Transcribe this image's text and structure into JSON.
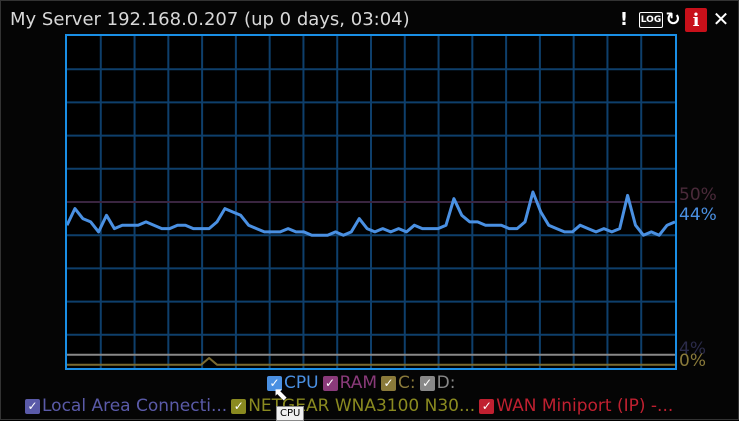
{
  "window": {
    "title": "My Server 192.168.0.207 (up 0 days, 03:04)"
  },
  "title_buttons": {
    "alert": "!",
    "log": "LOG",
    "refresh": "↻",
    "info": "i",
    "close": "✕"
  },
  "colors": {
    "grid": "#0e3f6b",
    "cpu": "#4a90e2",
    "ram": "#3a2540",
    "disk_c": "#7a6a30",
    "disk_d": "#888888",
    "frame": "#1a8fe6"
  },
  "readouts": {
    "ram": "50%",
    "cpu": "44%",
    "low_a": "4%",
    "low_b": "0%"
  },
  "legend": {
    "row1": [
      {
        "label": "CPU",
        "color": "#4a90e2"
      },
      {
        "label": "RAM",
        "color": "#8a3a7a"
      },
      {
        "label": "C:",
        "color": "#8a7a3a"
      },
      {
        "label": "D:",
        "color": "#888888"
      }
    ],
    "row2": [
      {
        "label": "Local Area Connecti...",
        "color": "#5a5aa8"
      },
      {
        "label": "NETGEAR WNA3100 N30...",
        "color": "#8a8a20"
      },
      {
        "label": "WAN Miniport (IP) -...",
        "color": "#c02030"
      }
    ]
  },
  "tooltip": "CPU",
  "chart_data": {
    "type": "line",
    "ylim": [
      0,
      100
    ],
    "grid": true,
    "series": [
      {
        "name": "CPU",
        "values": [
          43,
          48,
          45,
          44,
          41,
          46,
          42,
          43,
          43,
          43,
          44,
          43,
          42,
          42,
          43,
          43,
          42,
          42,
          42,
          44,
          48,
          47,
          46,
          43,
          42,
          41,
          41,
          41,
          42,
          41,
          41,
          40,
          40,
          40,
          41,
          40,
          41,
          45,
          42,
          41,
          42,
          41,
          42,
          41,
          43,
          42,
          42,
          42,
          43,
          51,
          46,
          44,
          44,
          43,
          43,
          43,
          42,
          42,
          44,
          53,
          47,
          43,
          42,
          41,
          41,
          43,
          42,
          41,
          42,
          41,
          42,
          52,
          43,
          40,
          41,
          40,
          43,
          44
        ]
      },
      {
        "name": "RAM",
        "values": [
          50,
          50,
          50,
          50,
          50,
          50,
          50,
          50,
          50,
          50,
          50,
          50,
          50,
          50,
          50,
          50,
          50,
          50,
          50,
          50,
          50,
          50,
          50,
          50,
          50,
          50,
          50,
          50,
          50,
          50,
          50,
          50,
          50,
          50,
          50,
          50,
          50,
          50,
          50,
          50,
          50,
          50,
          50,
          50,
          50,
          50,
          50,
          50,
          50,
          50,
          50,
          50,
          50,
          50,
          50,
          50,
          50,
          50,
          50,
          50,
          50,
          50,
          50,
          50,
          50,
          50,
          50,
          50,
          50,
          50,
          50,
          50,
          50,
          50,
          50,
          50,
          50,
          50
        ]
      },
      {
        "name": "C:",
        "values": [
          1,
          1,
          1,
          1,
          1,
          1,
          1,
          1,
          1,
          1,
          1,
          1,
          1,
          1,
          1,
          1,
          1,
          1,
          3,
          1,
          1,
          1,
          1,
          1,
          1,
          1,
          1,
          1,
          1,
          1,
          1,
          1,
          1,
          1,
          1,
          1,
          1,
          1,
          1,
          1,
          1,
          1,
          1,
          1,
          1,
          1,
          1,
          1,
          1,
          1,
          1,
          1,
          1,
          1,
          1,
          1,
          1,
          1,
          1,
          1,
          1,
          1,
          1,
          1,
          1,
          1,
          1,
          1,
          1,
          1,
          1,
          1,
          1,
          1,
          1,
          1,
          1,
          1
        ]
      },
      {
        "name": "D:",
        "values": [
          4,
          4,
          4,
          4,
          4,
          4,
          4,
          4,
          4,
          4,
          4,
          4,
          4,
          4,
          4,
          4,
          4,
          4,
          4,
          4,
          4,
          4,
          4,
          4,
          4,
          4,
          4,
          4,
          4,
          4,
          4,
          4,
          4,
          4,
          4,
          4,
          4,
          4,
          4,
          4,
          4,
          4,
          4,
          4,
          4,
          4,
          4,
          4,
          4,
          4,
          4,
          4,
          4,
          4,
          4,
          4,
          4,
          4,
          4,
          4,
          4,
          4,
          4,
          4,
          4,
          4,
          4,
          4,
          4,
          4,
          4,
          4,
          4,
          4,
          4,
          4,
          4,
          4
        ]
      }
    ]
  }
}
